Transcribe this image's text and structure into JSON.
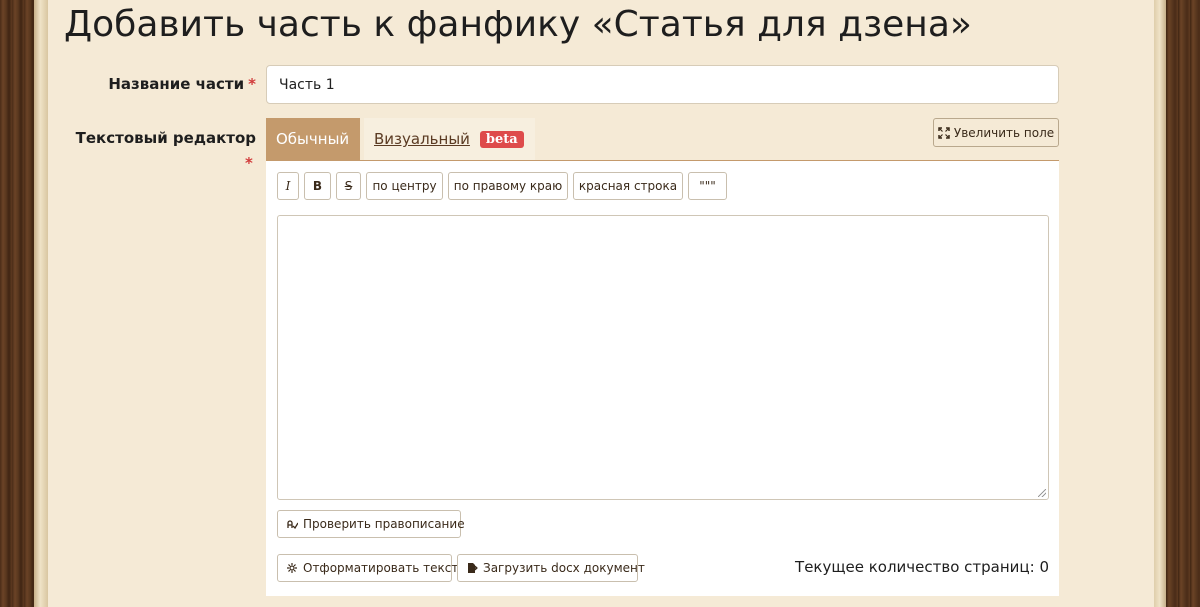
{
  "page": {
    "title": "Добавить часть к фанфику «Статья для дзена»"
  },
  "form": {
    "part_name_label": "Название части",
    "required_mark": "*",
    "part_name_value": "Часть 1",
    "editor_label": "Текстовый редактор"
  },
  "tabs": {
    "plain_label": "Обычный",
    "visual_label": "Визуальный",
    "beta_badge": "beta",
    "expand_label": "Увеличить поле"
  },
  "toolbar": {
    "italic": "I",
    "bold": "B",
    "strike": "S",
    "center": "по центру",
    "right": "по правому краю",
    "indent": "красная строка",
    "quote": "\"\"\""
  },
  "editor": {
    "text": ""
  },
  "actions": {
    "spellcheck": "Проверить правописание",
    "format": "Отформатировать текст",
    "upload": "Загрузить docx документ"
  },
  "footer": {
    "page_count_label": "Текущее количество страниц:",
    "page_count_value": "0"
  },
  "colors": {
    "accent": "#c49a6c",
    "required": "#d13b3b",
    "beta": "#de4b4b",
    "page_bg": "#f5ead6"
  },
  "icons": {
    "expand": "expand-icon",
    "spellcheck": "spellcheck-icon",
    "format": "format-icon",
    "upload": "file-upload-icon"
  }
}
